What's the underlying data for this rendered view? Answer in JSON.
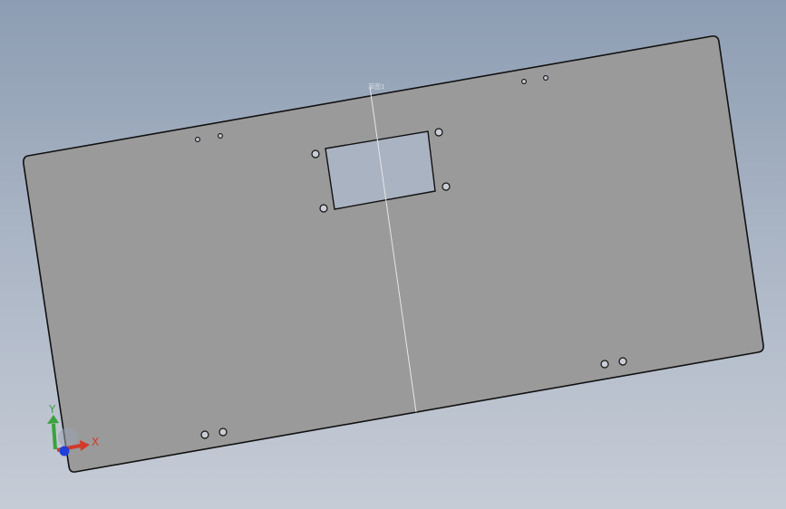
{
  "viewport": {
    "background_top": "#8d9db3",
    "background_bottom": "#c6ccd6"
  },
  "part": {
    "face_color": "#9a9a9a",
    "edge_color": "#111111",
    "sketch_line_color": "#e6e6e6",
    "sketch_label": "草图1"
  },
  "triad": {
    "x_label": "X",
    "y_label": "Y",
    "x_color": "#d23a2a",
    "y_color": "#3aa23a",
    "z_color": "#1f3fd8"
  }
}
